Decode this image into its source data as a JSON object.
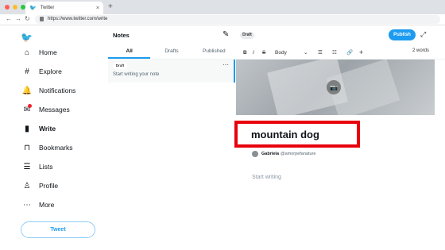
{
  "browser": {
    "tab_title": "Twitter",
    "url": "https://www.twitter.com/write",
    "new_tab": "+",
    "tab_close": "×",
    "back": "←",
    "forward": "→",
    "reload": "↻"
  },
  "sidebar": {
    "logo": "🐦",
    "items": [
      {
        "label": "Home",
        "icon": "⌂"
      },
      {
        "label": "Explore",
        "icon": "#"
      },
      {
        "label": "Notifications",
        "icon": "🔔"
      },
      {
        "label": "Messages",
        "icon": "✉"
      },
      {
        "label": "Write",
        "icon": "▮"
      },
      {
        "label": "Bookmarks",
        "icon": "⊓"
      },
      {
        "label": "Lists",
        "icon": "☰"
      },
      {
        "label": "Profile",
        "icon": "♙"
      },
      {
        "label": "More",
        "icon": "⋯"
      }
    ],
    "tweet_button": "Tweet"
  },
  "notes": {
    "title": "Notes",
    "compose_icon": "✎",
    "status": "Draft",
    "publish": "Publish",
    "expand_icon": "⤢",
    "tabs": [
      "All",
      "Drafts",
      "Published"
    ],
    "card": {
      "badge": "Draft",
      "text": "Start writing your note",
      "more": "···"
    }
  },
  "toolbar": {
    "bold": "B",
    "italic": "I",
    "strike": "S",
    "style": "Body",
    "chevron": "⌄",
    "list1": "☰",
    "list2": "☷",
    "link": "🔗",
    "add": "+",
    "word_count": "2 words"
  },
  "editor": {
    "camera": "📷",
    "title": "mountain dog",
    "author_name": "Gabriela",
    "author_handle": "@amorpefanature",
    "body_placeholder": "Start writing"
  }
}
